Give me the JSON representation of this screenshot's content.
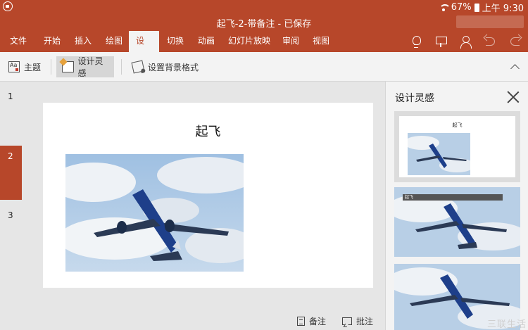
{
  "status_bar": {
    "battery": "67%",
    "time": "上午 9:30"
  },
  "window": {
    "title": "起飞-2-带备注 - 已保存"
  },
  "tabs": [
    {
      "label": "文件"
    },
    {
      "label": "开始"
    },
    {
      "label": "插入"
    },
    {
      "label": "绘图"
    },
    {
      "label": "设计",
      "active": true
    },
    {
      "label": "切换"
    },
    {
      "label": "动画"
    },
    {
      "label": "幻灯片放映"
    },
    {
      "label": "审阅"
    },
    {
      "label": "视图"
    }
  ],
  "ribbon": {
    "themes_label": "主题",
    "design_ideas_label": "设计灵感",
    "format_bg_label": "设置背景格式"
  },
  "slides": [
    {
      "number": "1"
    },
    {
      "number": "2",
      "active": true
    },
    {
      "number": "3"
    }
  ],
  "slide": {
    "title": "起飞"
  },
  "bottom_bar": {
    "notes_label": "备注",
    "comments_label": "批注"
  },
  "designer_pane": {
    "title": "设计灵感",
    "options": [
      {
        "mini_title": "起飞"
      },
      {
        "mini_title": "起飞"
      },
      {
        "mini_title": ""
      }
    ]
  },
  "watermark": "三联生活",
  "colors": {
    "accent": "#b7472a",
    "ribbon_bg": "#f3f3f3",
    "canvas_bg": "#e6e6e6"
  }
}
